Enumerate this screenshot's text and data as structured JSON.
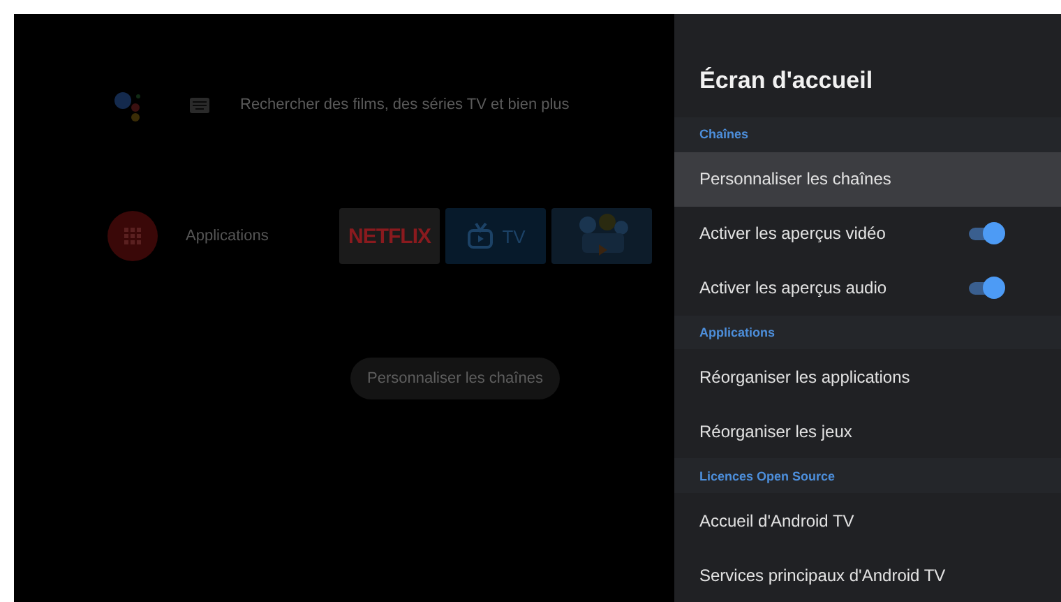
{
  "background": {
    "search": {
      "placeholder": "Rechercher des films, des séries TV et bien plus"
    },
    "apps_row": {
      "label": "Applications",
      "tiles": [
        {
          "kind": "netflix",
          "label": "NETFLIX"
        },
        {
          "kind": "tv",
          "label": "TV"
        },
        {
          "kind": "game"
        }
      ]
    },
    "button": "Personnaliser les chaînes"
  },
  "panel": {
    "title": "Écran d'accueil",
    "items": [
      {
        "kind": "header",
        "label": "Chaînes"
      },
      {
        "kind": "item",
        "label": "Personnaliser les chaînes",
        "selected": true
      },
      {
        "kind": "toggle",
        "label": "Activer les aperçus vidéo",
        "on": true,
        "selected": false
      },
      {
        "kind": "toggle",
        "label": "Activer les aperçus audio",
        "on": true,
        "selected": false
      },
      {
        "kind": "header",
        "label": "Applications"
      },
      {
        "kind": "item",
        "label": "Réorganiser les applications",
        "selected": false
      },
      {
        "kind": "item",
        "label": "Réorganiser les jeux",
        "selected": false
      },
      {
        "kind": "header",
        "label": "Licences Open Source"
      },
      {
        "kind": "item",
        "label": "Accueil d'Android TV",
        "selected": false
      },
      {
        "kind": "item",
        "label": "Services principaux d'Android TV",
        "selected": false
      }
    ]
  }
}
